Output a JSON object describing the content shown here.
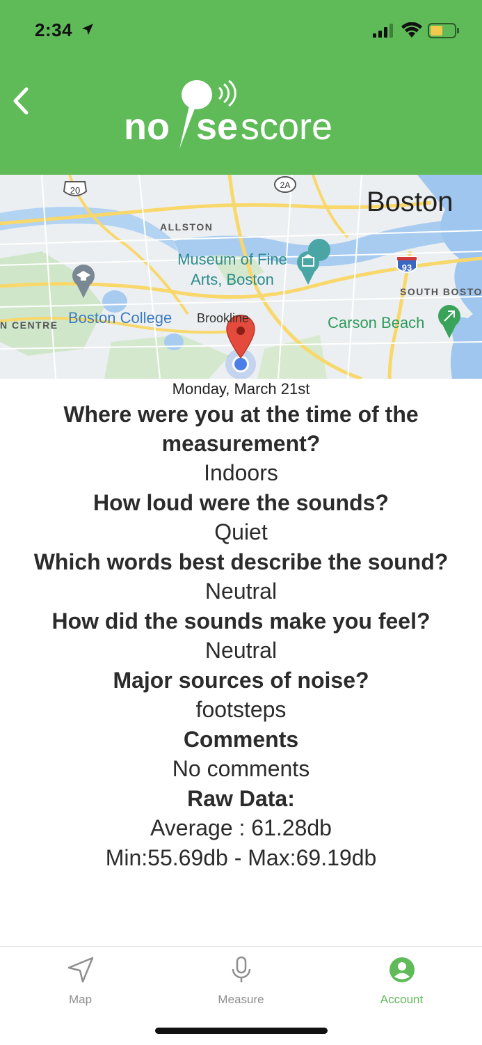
{
  "status_bar": {
    "time": "2:34",
    "battery_color": "#f2c94c"
  },
  "header": {
    "brand": "noisescore",
    "brand_color": "#5fba58",
    "back_icon": "chevron-left-icon"
  },
  "map": {
    "labels": {
      "boston": "Boston",
      "allston": "ALLSTON",
      "museum_line1": "Museum of Fine",
      "museum_line2": "Arts, Boston",
      "south_boston": "SOUTH BOSTO",
      "newton_centre": "N CENTRE",
      "boston_college": "Boston College",
      "brookline": "Brookline",
      "carson_beach": "Carson Beach"
    },
    "shields": [
      "20",
      "2A",
      "93"
    ]
  },
  "details": {
    "date": "Monday, March 21st",
    "q_location": "Where were you at the time of the measurement?",
    "a_location": "Indoors",
    "q_loudness": "How loud were the sounds?",
    "a_loudness": "Quiet",
    "q_words": "Which words best describe the sound?",
    "a_words": "Neutral",
    "q_feel": "How did the sounds make you feel?",
    "a_feel": "Neutral",
    "q_sources": "Major sources of noise?",
    "a_sources": "footsteps",
    "q_comments": "Comments",
    "a_comments": "No comments",
    "q_raw": "Raw Data:",
    "a_average": "Average : 61.28db",
    "a_minmax": "Min:55.69db - Max:69.19db"
  },
  "tabbar": {
    "tabs": [
      {
        "label": "Map",
        "icon": "navigation-arrow-icon"
      },
      {
        "label": "Measure",
        "icon": "microphone-icon"
      },
      {
        "label": "Account",
        "icon": "account-circle-icon"
      }
    ],
    "active_color": "#5fba58",
    "inactive_color": "#8e8e8e"
  }
}
